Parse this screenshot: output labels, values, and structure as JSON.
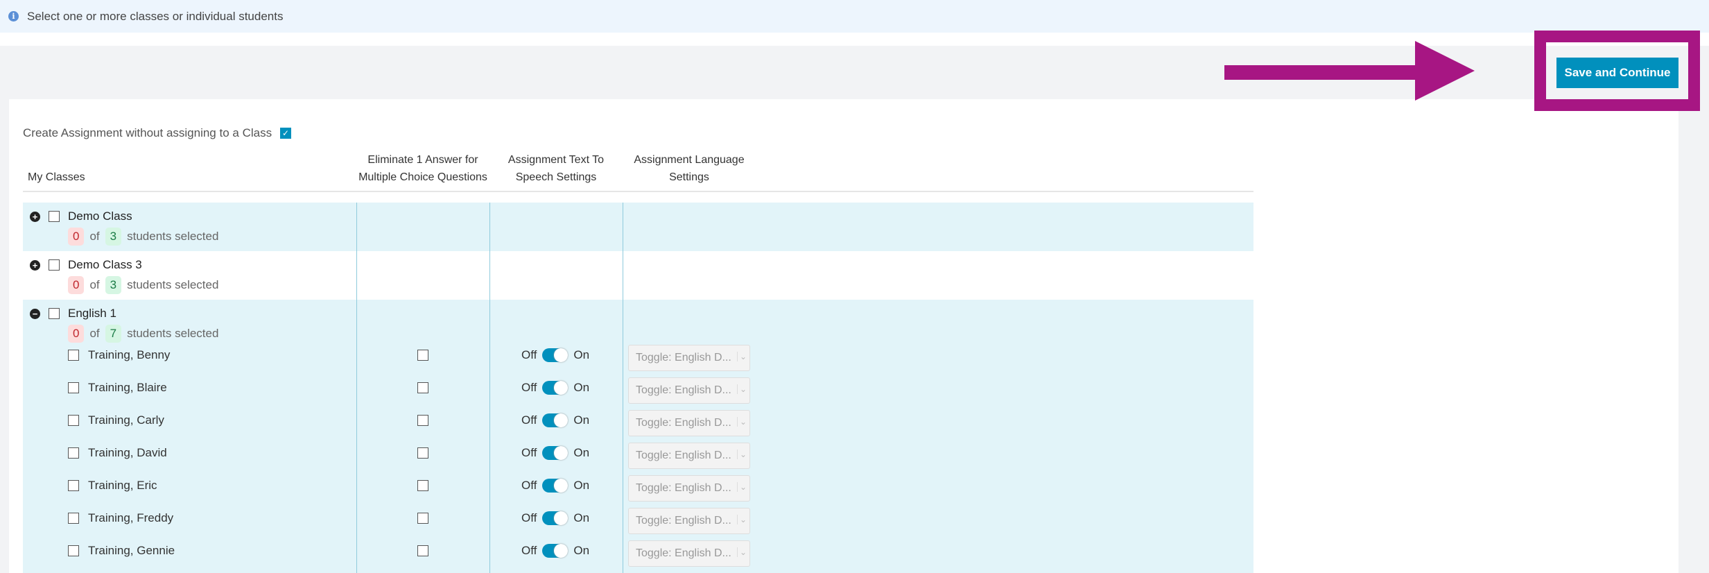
{
  "info": {
    "icon": "info-icon",
    "text": "Select one or more classes or individual students"
  },
  "actions": {
    "save_label": "Save and Continue",
    "highlight_color": "#a71683",
    "button_color": "#0190bd"
  },
  "create_without_class": {
    "label": "Create Assignment without assigning to a Class",
    "checked": true
  },
  "headers": {
    "classes": "My Classes",
    "eliminate": "Eliminate 1 Answer for Multiple Choice Questions",
    "tts": "Assignment Text To Speech Settings",
    "language": "Assignment Language Settings"
  },
  "classes": [
    {
      "name": "Demo Class",
      "selected": "0",
      "of": "of",
      "total": "3",
      "suffix": "students selected",
      "expanded": false
    },
    {
      "name": "Demo Class 3",
      "selected": "0",
      "of": "of",
      "total": "3",
      "suffix": "students selected",
      "expanded": false
    },
    {
      "name": "English 1",
      "selected": "0",
      "of": "of",
      "total": "7",
      "suffix": "students selected",
      "expanded": true
    }
  ],
  "toggle": {
    "off": "Off",
    "on": "On"
  },
  "language_select": "Toggle: English D...",
  "students": [
    "Training, Benny",
    "Training, Blaire",
    "Training, Carly",
    "Training, David",
    "Training, Eric",
    "Training, Freddy",
    "Training, Gennie"
  ]
}
